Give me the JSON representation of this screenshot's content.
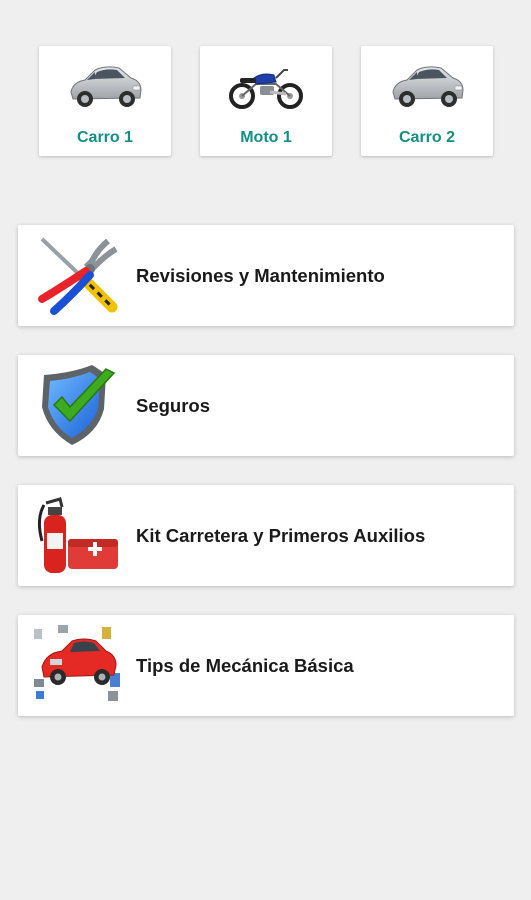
{
  "vehicles": [
    {
      "label": "Carro 1",
      "icon": "car-icon"
    },
    {
      "label": "Moto 1",
      "icon": "motorcycle-icon"
    },
    {
      "label": "Carro 2",
      "icon": "car-icon"
    }
  ],
  "menu": [
    {
      "label": "Revisiones y Mantenimiento",
      "icon": "tools-icon"
    },
    {
      "label": "Seguros",
      "icon": "shield-check-icon"
    },
    {
      "label": "Kit Carretera y Primeros Auxilios",
      "icon": "fire-extinguisher-icon"
    },
    {
      "label": "Tips de Mecánica Básica",
      "icon": "car-parts-icon"
    }
  ],
  "colors": {
    "background": "#efefef",
    "card": "#ffffff",
    "vehicle_label": "#138f86",
    "menu_text": "#1a1a1a"
  }
}
